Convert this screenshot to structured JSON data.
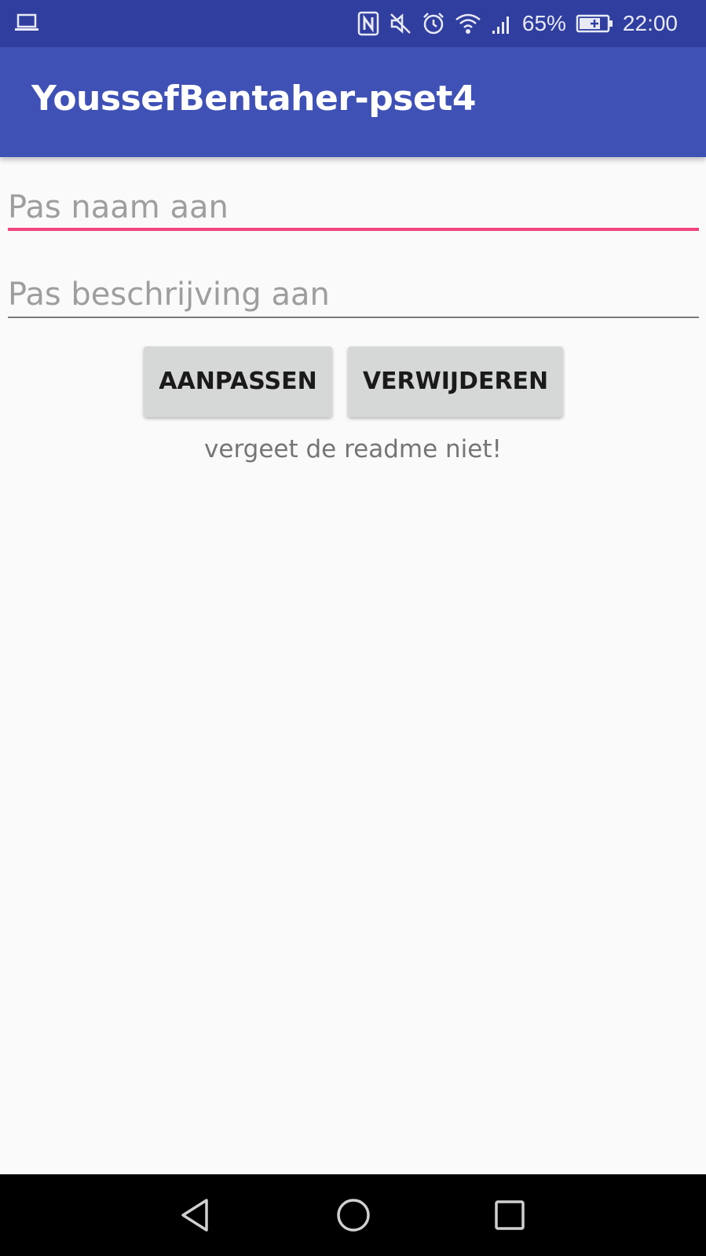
{
  "status_bar": {
    "left_icon": "laptop-icon",
    "icons": [
      "nfc-icon",
      "mute-icon",
      "alarm-icon",
      "wifi-icon",
      "signal-icon",
      "battery-charging-icon"
    ],
    "battery_percent": "65%",
    "time": "22:00"
  },
  "app_bar": {
    "title": "YoussefBentaher-pset4"
  },
  "form": {
    "name_field": {
      "placeholder": "Pas naam aan",
      "value": ""
    },
    "description_field": {
      "placeholder": "Pas beschrijving aan",
      "value": ""
    },
    "update_button_label": "AANPASSEN",
    "delete_button_label": "VERWIJDEREN",
    "hint_text": "vergeet de readme niet!"
  },
  "nav_bar": {
    "buttons": [
      "back-icon",
      "home-icon",
      "recents-icon"
    ]
  },
  "colors": {
    "status_bar": "#303f9f",
    "app_bar": "#3f51b5",
    "accent": "#f0457f",
    "background": "#fafafa",
    "button": "#d6d7d7"
  }
}
